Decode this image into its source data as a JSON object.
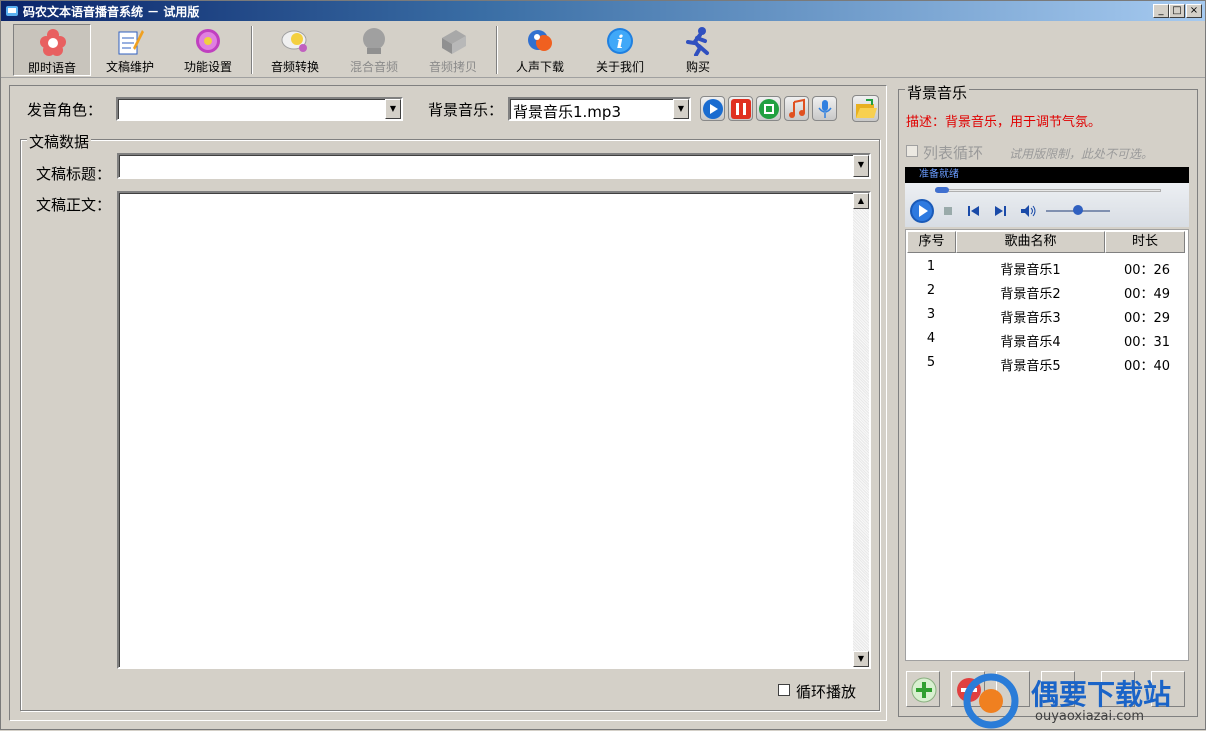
{
  "window": {
    "title": "码农文本语音播音系统 － 试用版",
    "controls": [
      "_",
      "□",
      "×"
    ]
  },
  "toolbar": {
    "items": [
      {
        "label": "即时语音",
        "icon": "flower-icon",
        "state": "active"
      },
      {
        "label": "文稿维护",
        "icon": "document-edit-icon",
        "state": "normal"
      },
      {
        "label": "功能设置",
        "icon": "gear-icon",
        "state": "normal"
      },
      {
        "label": "音频转换",
        "icon": "audio-convert-icon",
        "state": "normal"
      },
      {
        "label": "混合音频",
        "icon": "mix-audio-icon",
        "state": "disabled"
      },
      {
        "label": "音频拷贝",
        "icon": "audio-copy-icon",
        "state": "disabled"
      },
      {
        "label": "人声下载",
        "icon": "voice-download-icon",
        "state": "normal"
      },
      {
        "label": "关于我们",
        "icon": "info-icon",
        "state": "normal"
      },
      {
        "label": "购买",
        "icon": "runner-icon",
        "state": "normal"
      }
    ]
  },
  "main": {
    "voice_label": "发音角色：",
    "voice_value": "",
    "bgm_label": "背景音乐：",
    "bgm_value": "背景音乐1.mp3",
    "group_title": "文稿数据",
    "doc_title_label": "文稿标题：",
    "doc_title_value": "",
    "doc_body_label": "文稿正文：",
    "doc_body_value": "",
    "loop_label": "循环播放"
  },
  "bgm_panel": {
    "title": "背景音乐",
    "description": "描述：背景音乐，用于调节气氛。",
    "list_loop_label": "列表循环",
    "trial_note": "试用版限制，此处不可选。",
    "player_status": "准备就绪",
    "columns": [
      "序号",
      "歌曲名称",
      "时长"
    ],
    "rows": [
      {
        "no": "1",
        "name": "背景音乐1",
        "duration": "00：26"
      },
      {
        "no": "2",
        "name": "背景音乐2",
        "duration": "00：49"
      },
      {
        "no": "3",
        "name": "背景音乐3",
        "duration": "00：29"
      },
      {
        "no": "4",
        "name": "背景音乐4",
        "duration": "00：31"
      },
      {
        "no": "5",
        "name": "背景音乐5",
        "duration": "00：40"
      }
    ]
  },
  "watermark": {
    "text": "偶要下载站",
    "url_text": "ouyaoxiazai.com"
  },
  "colors": {
    "accent_red": "#e00000",
    "title_blue": "#0a246a",
    "face": "#d4d0c8"
  }
}
